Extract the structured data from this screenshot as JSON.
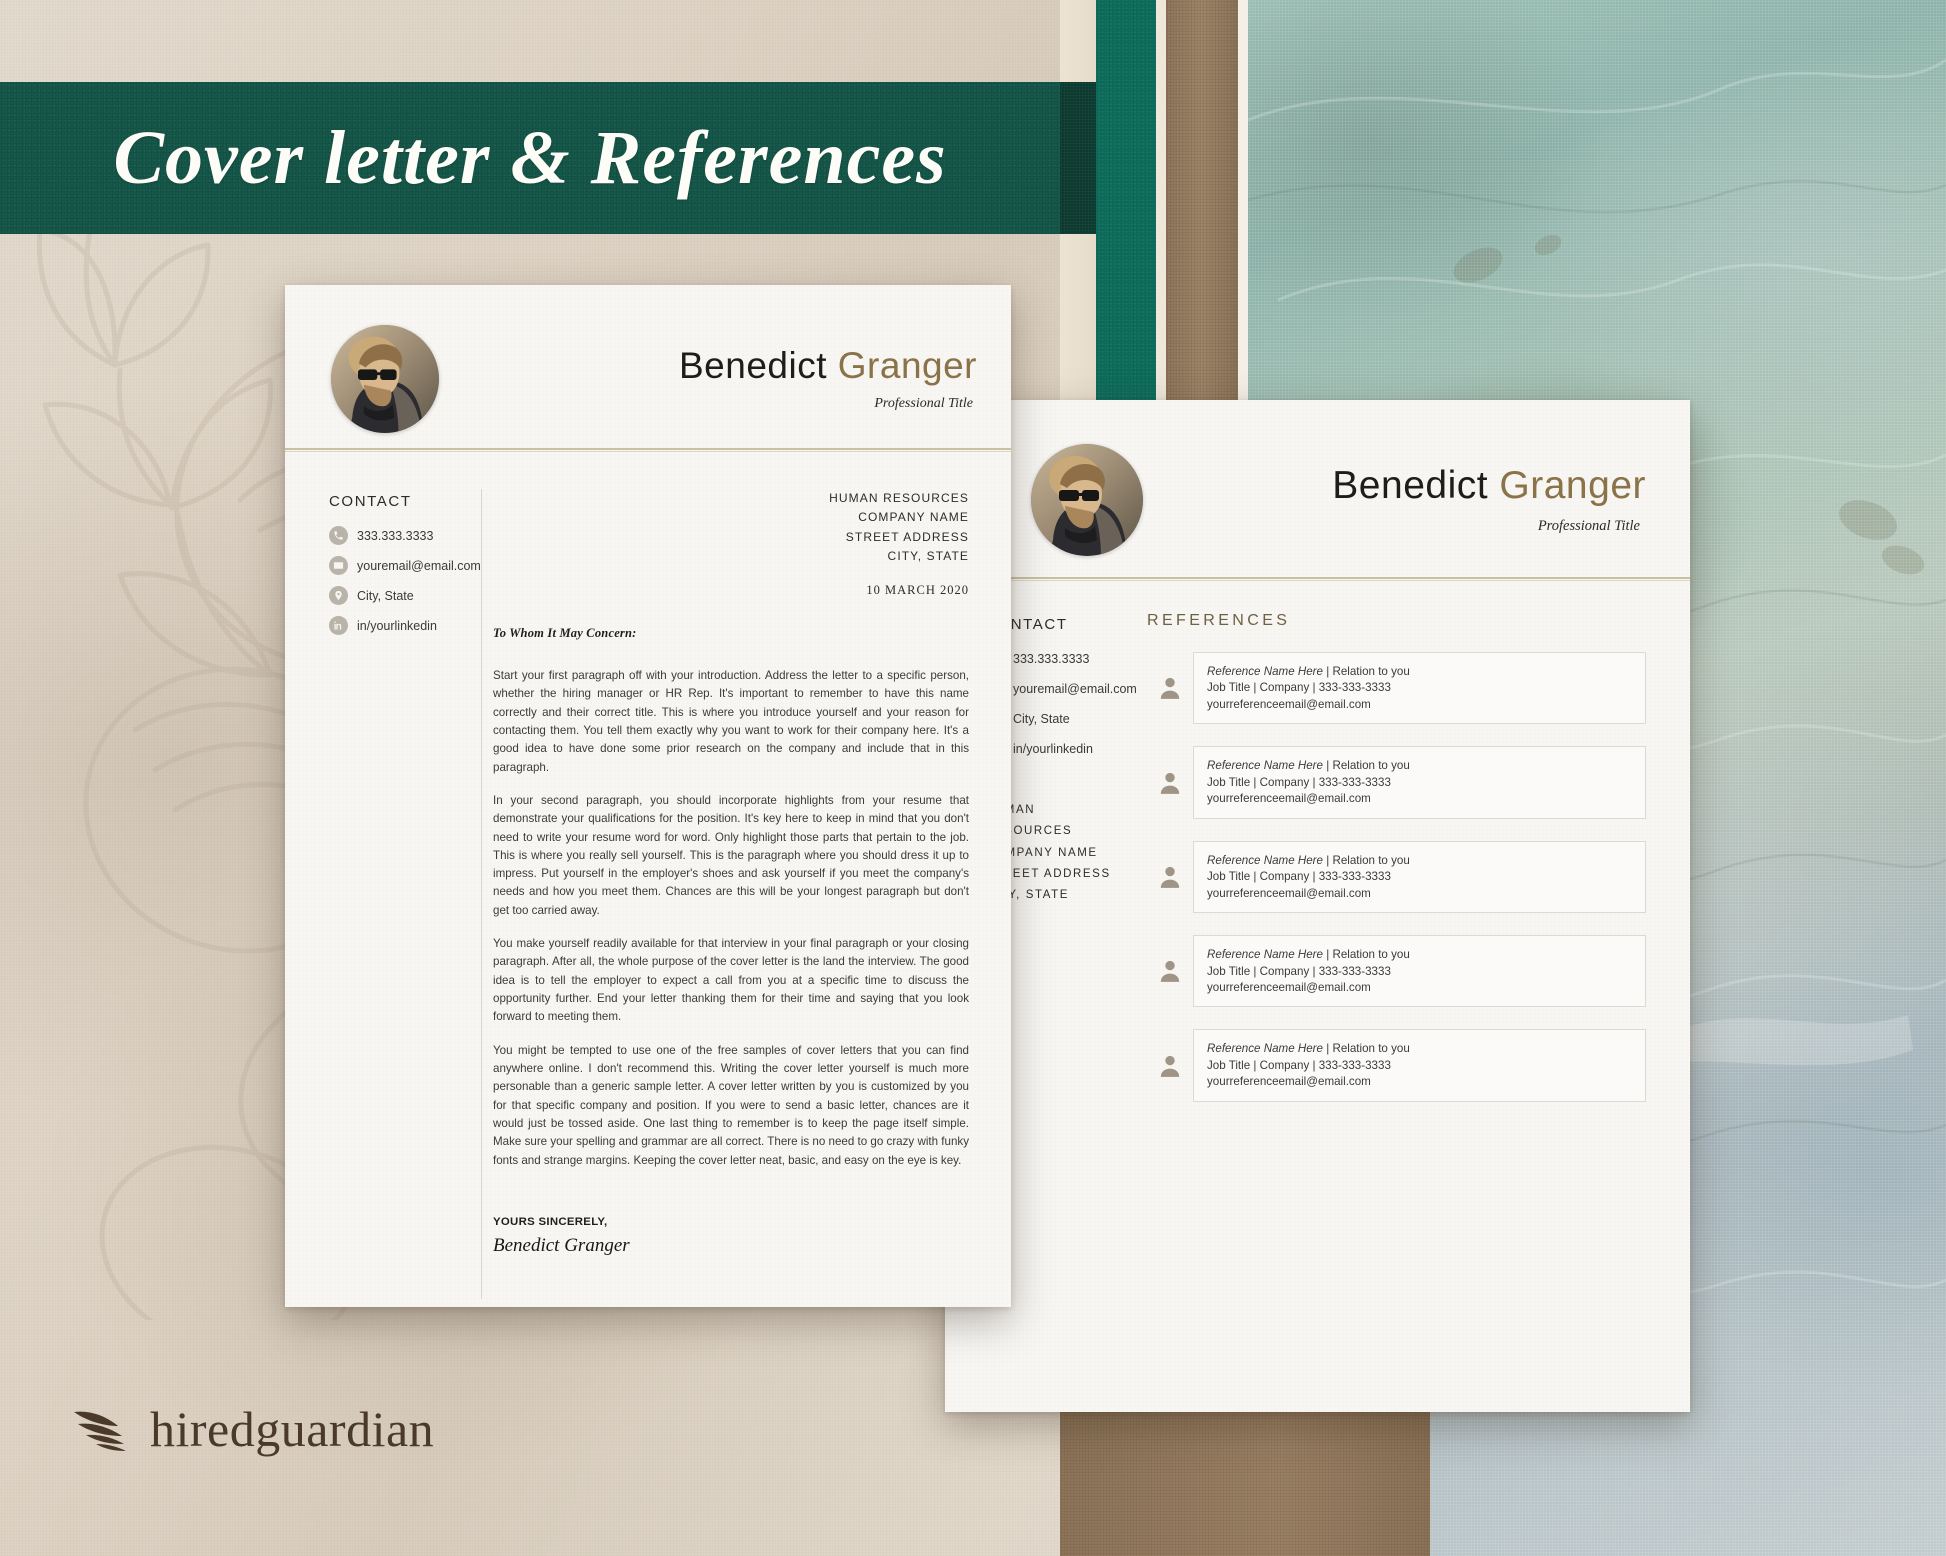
{
  "banner": {
    "title": "Cover letter & References"
  },
  "brand": {
    "logo_text": "hiredguardian",
    "logo_icon": "feather-wing-icon"
  },
  "person": {
    "first_name": "Benedict",
    "last_name": "Granger",
    "professional_title": "Professional Title"
  },
  "cover_letter": {
    "contact_heading": "CONTACT",
    "contact": [
      {
        "icon": "phone-icon",
        "value": "333.333.3333"
      },
      {
        "icon": "email-icon",
        "value": "youremail@email.com"
      },
      {
        "icon": "location-pin-icon",
        "value": "City, State"
      },
      {
        "icon": "linkedin-icon",
        "value": "in/yourlinkedin"
      }
    ],
    "recipient": [
      "HUMAN RESOURCES",
      "COMPANY NAME",
      "STREET ADDRESS",
      "CITY, STATE"
    ],
    "date": "10 MARCH 2020",
    "salutation": "To Whom It May Concern:",
    "paragraphs": [
      "Start your first paragraph off with your introduction. Address the letter to a specific person, whether the hiring manager or HR Rep. It's important to remember to have this name correctly and their correct title. This is where you introduce yourself and your reason for contacting them. You tell them exactly why you want to work for their company here. It's a good idea to have done some prior research on the company and include that in this paragraph.",
      "In your second paragraph, you should incorporate highlights from your resume that demonstrate your qualifications for the position. It's key here to keep in mind that you don't need to write your resume word for word. Only highlight those parts that pertain to the job. This is where you really sell yourself. This is the paragraph where you should dress it up to impress. Put yourself in the employer's shoes and ask yourself if you meet the company's needs and how you meet them. Chances are this will be your longest paragraph but don't get too carried away.",
      "You make yourself readily available for that interview in your final paragraph or your closing paragraph. After all, the whole purpose of the cover letter is the land the interview. The good idea is to tell the employer to expect a call from you at a specific time to discuss the opportunity further. End your letter thanking them for their time and saying that you look forward to meeting them.",
      "You might be tempted to use one of the free samples of cover letters that you can find anywhere online. I don't recommend this. Writing the cover letter yourself is much more personable than a generic sample letter. A cover letter written by you is customized by you for that specific company and position. If you were to send a basic letter, chances are it would just be tossed aside. One last thing to remember is to keep the page itself simple. Make sure your spelling and grammar are all correct. There is no need to go crazy with funky fonts and strange margins. Keeping the cover letter neat, basic, and easy on the eye is key."
    ],
    "signoff": "YOURS SINCERELY,",
    "signature": "Benedict Granger"
  },
  "references_page": {
    "contact_heading": "CONTACT",
    "contact": [
      {
        "icon": "phone-icon",
        "value": "333.333.3333"
      },
      {
        "icon": "email-icon",
        "value": "youremail@email.com"
      },
      {
        "icon": "location-pin-icon",
        "value": "City, State"
      },
      {
        "icon": "linkedin-icon",
        "value": "in/yourlinkedin"
      }
    ],
    "recipient": [
      "HUMAN RESOURCES",
      "COMPANY NAME",
      "STREET ADDRESS",
      "CITY, STATE"
    ],
    "section_heading": "REFERENCES",
    "references": [
      {
        "name": "Reference Name Here",
        "relation": " | Relation to you",
        "line2": "Job Title | Company | 333-333-3333",
        "line3": "yourreferenceemail@email.com"
      },
      {
        "name": "Reference Name Here",
        "relation": " | Relation to you",
        "line2": "Job Title | Company | 333-333-3333",
        "line3": "yourreferenceemail@email.com"
      },
      {
        "name": "Reference Name Here",
        "relation": " | Relation to you",
        "line2": "Job Title | Company | 333-333-3333",
        "line3": "yourreferenceemail@email.com"
      },
      {
        "name": "Reference Name Here",
        "relation": " | Relation to you",
        "line2": "Job Title | Company | 333-333-3333",
        "line3": "yourreferenceemail@email.com"
      },
      {
        "name": "Reference Name Here",
        "relation": " | Relation to you",
        "line2": "Job Title | Company | 333-333-3333",
        "line3": "yourreferenceemail@email.com"
      }
    ]
  },
  "colors": {
    "banner_green": "#15584a",
    "stripe_green": "#0e6e5d",
    "dark_green": "#0c392f",
    "kraft_brown": "#8d7459",
    "gold_accent": "#8a7249",
    "rule_gold": "#c9bfa4",
    "background_beige": "#ded3c4",
    "paper_white": "#f7f6f3"
  }
}
